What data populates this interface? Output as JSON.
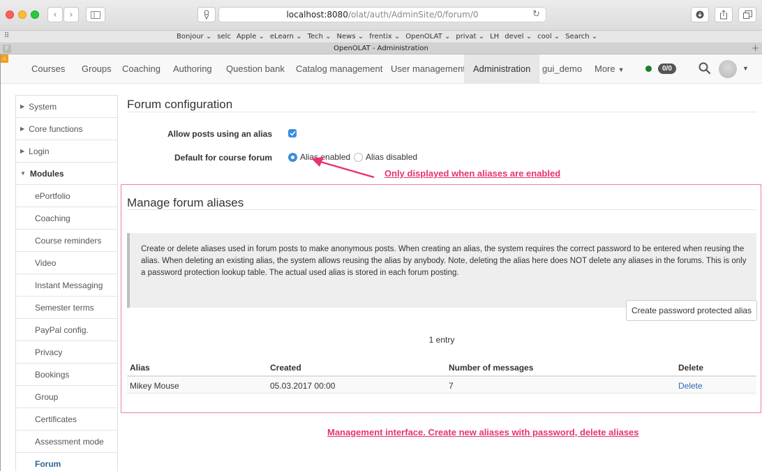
{
  "browser": {
    "url_host": "localhost:8080",
    "url_path": "/olat/auth/AdminSite/0/forum/0",
    "bookmarks": [
      "Bonjour ⌄",
      "selc",
      "Apple ⌄",
      "eLearn ⌄",
      "Tech ⌄",
      "News ⌄",
      "frentix ⌄",
      "OpenOLAT ⌄",
      "privat ⌄",
      "LH",
      "devel ⌄",
      "cool ⌄",
      "Search ⌄"
    ],
    "tab_title": "OpenOLAT - Administration"
  },
  "topnav": {
    "courses": "Courses",
    "groups": "Groups",
    "coaching": "Coaching",
    "authoring": "Authoring",
    "question_bank": "Question bank",
    "catalog_management": "Catalog management",
    "user_management": "User management",
    "administration": "Administration",
    "gui_demo": "gui_demo",
    "more": "More",
    "badge": "0/0",
    "online_color": "#1e7d2a"
  },
  "sidebar": {
    "system": "System",
    "core_functions": "Core functions",
    "login": "Login",
    "modules": "Modules",
    "items": [
      "ePortfolio",
      "Coaching",
      "Course reminders",
      "Video",
      "Instant Messaging",
      "Semester terms",
      "PayPal config.",
      "Privacy",
      "Bookings",
      "Group",
      "Certificates",
      "Assessment mode",
      "Forum"
    ]
  },
  "forum_config": {
    "title": "Forum configuration",
    "allow_alias_label": "Allow posts using an alias",
    "allow_alias_checked": true,
    "default_label": "Default for course forum",
    "radio_enabled": "Alias enabled",
    "radio_disabled": "Alias disabled",
    "selected": "Alias enabled"
  },
  "annotations": {
    "top": "Only displayed when aliases are enabled",
    "bottom": "Management interface. Create new aliases with password, delete aliases",
    "color": "#e8336e"
  },
  "manage": {
    "title": "Manage forum aliases",
    "info": "Create or delete aliases used in forum posts to make anonymous posts. When creating an alias, the system requires the correct password to be entered when reusing the alias. When deleting an existing alias, the system allows reusing the alias by anybody. Note, deleting the alias here does NOT delete any aliases in the forums. This is only a password protection lookup table. The actual used alias is stored in each forum posting.",
    "create_button": "Create password protected alias",
    "entries": "1 entry",
    "columns": {
      "alias": "Alias",
      "created": "Created",
      "messages": "Number of messages",
      "delete": "Delete"
    },
    "rows": [
      {
        "alias": "Mikey Mouse",
        "created": "05.03.2017 00:00",
        "messages": "7",
        "delete": "Delete"
      }
    ]
  }
}
